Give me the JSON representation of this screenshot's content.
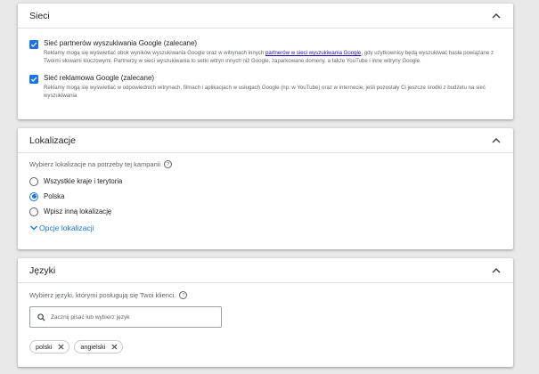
{
  "networks": {
    "title": "Sieci",
    "items": [
      {
        "label": "Sieć partnerów wyszukiwania Google (zalecane)",
        "desc_before": "Reklamy mogą się wyświetlać obok wyników wyszukiwania Google oraz w witrynach innych ",
        "desc_link": "partnerów w sieci wyszukiwania Google",
        "desc_after": ", gdy użytkownicy będą wyszukiwać hasła powiązane z Twoimi słowami kluczowymi. Partnerzy w sieci wyszukiwania to setki witryn innych niż Google, zaparkowane domeny, a także YouTube i inne witryny Google.",
        "checked": true
      },
      {
        "label": "Sieć reklamowa Google (zalecane)",
        "desc_before": "Reklamy mogą się wyświetlać w odpowiednich witrynach, filmach i aplikacjach w usługach Google (np. w YouTube) oraz w internecie, jeśli pozostały Ci jeszcze środki z budżetu na sieć wyszukiwania",
        "desc_link": "",
        "desc_after": "",
        "checked": true
      }
    ]
  },
  "locations": {
    "title": "Lokalizacje",
    "hint": "Wybierz lokalizacje na potrzeby tej kampanii",
    "options": [
      {
        "label": "Wszystkie kraje i terytoria",
        "selected": false
      },
      {
        "label": "Polska",
        "selected": true
      },
      {
        "label": "Wpisz inną lokalizację",
        "selected": false
      }
    ],
    "more_label": "Opcje lokalizacji"
  },
  "languages": {
    "title": "Języki",
    "hint": "Wybierz języki, którymi posługują się Twoi klienci.",
    "search_placeholder": "Zacznij pisać lub wybierz język",
    "chips": [
      "polski",
      "angielski"
    ]
  },
  "colors": {
    "accent": "#1a73e8",
    "link": "#1a0dab",
    "background": "#e9e9ea",
    "card": "#ffffff"
  },
  "icons": {
    "collapse": "chevron-up-icon",
    "help": "help-circle-icon",
    "search": "search-icon",
    "remove": "close-icon",
    "expand": "chevron-down-icon"
  }
}
